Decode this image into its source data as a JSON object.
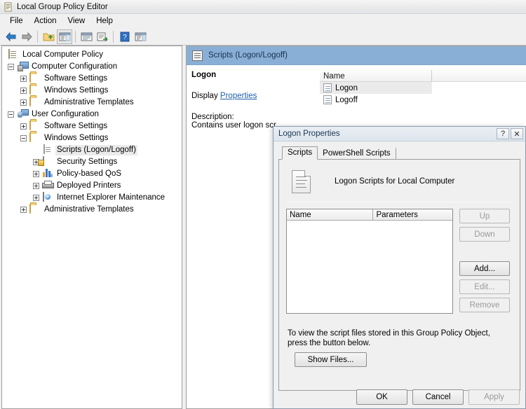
{
  "window": {
    "title": "Local Group Policy Editor",
    "icon": "console-icon"
  },
  "menubar": {
    "items": [
      {
        "label": "File"
      },
      {
        "label": "Action"
      },
      {
        "label": "View"
      },
      {
        "label": "Help"
      }
    ]
  },
  "toolbar": {
    "buttons": [
      {
        "name": "back-button",
        "icon": "left-arrow-icon",
        "title": "Back"
      },
      {
        "name": "forward-button",
        "icon": "right-arrow-icon",
        "title": "Forward"
      },
      {
        "name": "up-folder-button",
        "icon": "up-folder-icon",
        "title": "Up One Level"
      },
      {
        "name": "show-hide-tree-button",
        "icon": "tree-pane-icon",
        "title": "Show/Hide Console Tree"
      },
      {
        "name": "properties-button",
        "icon": "properties-icon",
        "title": "Properties"
      },
      {
        "name": "export-list-button",
        "icon": "export-list-icon",
        "title": "Export List"
      },
      {
        "name": "help-button",
        "icon": "help-question-icon",
        "title": "Help"
      },
      {
        "name": "show-hide-action-pane-button",
        "icon": "action-pane-icon",
        "title": "Show/Hide Action Pane"
      }
    ]
  },
  "tree": {
    "root": {
      "label": "Local Computer Policy",
      "icon": "console-icon"
    },
    "nodes": [
      {
        "label": "Computer Configuration",
        "icon": "computer-icon",
        "indent": 0,
        "twist": "minus"
      },
      {
        "label": "Software Settings",
        "icon": "folder-icon",
        "indent": 1,
        "twist": "plus"
      },
      {
        "label": "Windows Settings",
        "icon": "folder-icon",
        "indent": 1,
        "twist": "plus"
      },
      {
        "label": "Administrative Templates",
        "icon": "folder-icon",
        "indent": 1,
        "twist": "plus"
      },
      {
        "label": "User Configuration",
        "icon": "user-icon",
        "indent": 0,
        "twist": "minus"
      },
      {
        "label": "Software Settings",
        "icon": "folder-icon",
        "indent": 1,
        "twist": "plus"
      },
      {
        "label": "Windows Settings",
        "icon": "folder-icon",
        "indent": 1,
        "twist": "minus"
      },
      {
        "label": "Scripts (Logon/Logoff)",
        "icon": "script-icon",
        "indent": 2,
        "twist": "none",
        "selected": true
      },
      {
        "label": "Security Settings",
        "icon": "security-icon",
        "indent": 2,
        "twist": "plus"
      },
      {
        "label": "Policy-based QoS",
        "icon": "qos-chart-icon",
        "indent": 2,
        "twist": "plus"
      },
      {
        "label": "Deployed Printers",
        "icon": "printer-icon",
        "indent": 2,
        "twist": "plus"
      },
      {
        "label": "Internet Explorer Maintenance",
        "icon": "ie-icon",
        "indent": 2,
        "twist": "plus"
      },
      {
        "label": "Administrative Templates",
        "icon": "folder-icon",
        "indent": 1,
        "twist": "plus"
      }
    ]
  },
  "right_pane": {
    "header": {
      "title": "Scripts (Logon/Logoff)",
      "icon": "script-icon",
      "bg_color": "#8aafd6"
    },
    "details": {
      "title": "Logon",
      "display_label": "Display",
      "properties_link": "Properties",
      "description_label": "Description:",
      "description_text": "Contains user logon scr"
    },
    "list": {
      "columns": [
        "Name",
        ""
      ],
      "rows": [
        {
          "name": "Logon",
          "icon": "script-icon",
          "selected": true
        },
        {
          "name": "Logoff",
          "icon": "script-icon",
          "selected": false
        }
      ]
    }
  },
  "dialog": {
    "title": "Logon Properties",
    "help_button": "?",
    "close_button": "✕",
    "tabs": [
      {
        "label": "Scripts",
        "active": true
      },
      {
        "label": "PowerShell Scripts",
        "active": false
      }
    ],
    "script_header": {
      "icon": "document-script-icon",
      "title": "Logon Scripts for Local Computer"
    },
    "script_list": {
      "columns": [
        "Name",
        "Parameters"
      ],
      "rows": []
    },
    "side_buttons": [
      {
        "label": "Up",
        "enabled": false,
        "name": "up-button"
      },
      {
        "label": "Down",
        "enabled": false,
        "name": "down-button"
      },
      {
        "label": "Add...",
        "enabled": true,
        "name": "add-button"
      },
      {
        "label": "Edit...",
        "enabled": false,
        "name": "edit-button"
      },
      {
        "label": "Remove",
        "enabled": false,
        "name": "remove-button"
      }
    ],
    "note": "To view the script files stored in this Group Policy Object, press the button below.",
    "show_files_button": "Show Files...",
    "footer_buttons": [
      {
        "label": "OK",
        "enabled": true,
        "name": "ok-button"
      },
      {
        "label": "Cancel",
        "enabled": true,
        "name": "cancel-button"
      },
      {
        "label": "Apply",
        "enabled": false,
        "name": "apply-button"
      }
    ]
  }
}
